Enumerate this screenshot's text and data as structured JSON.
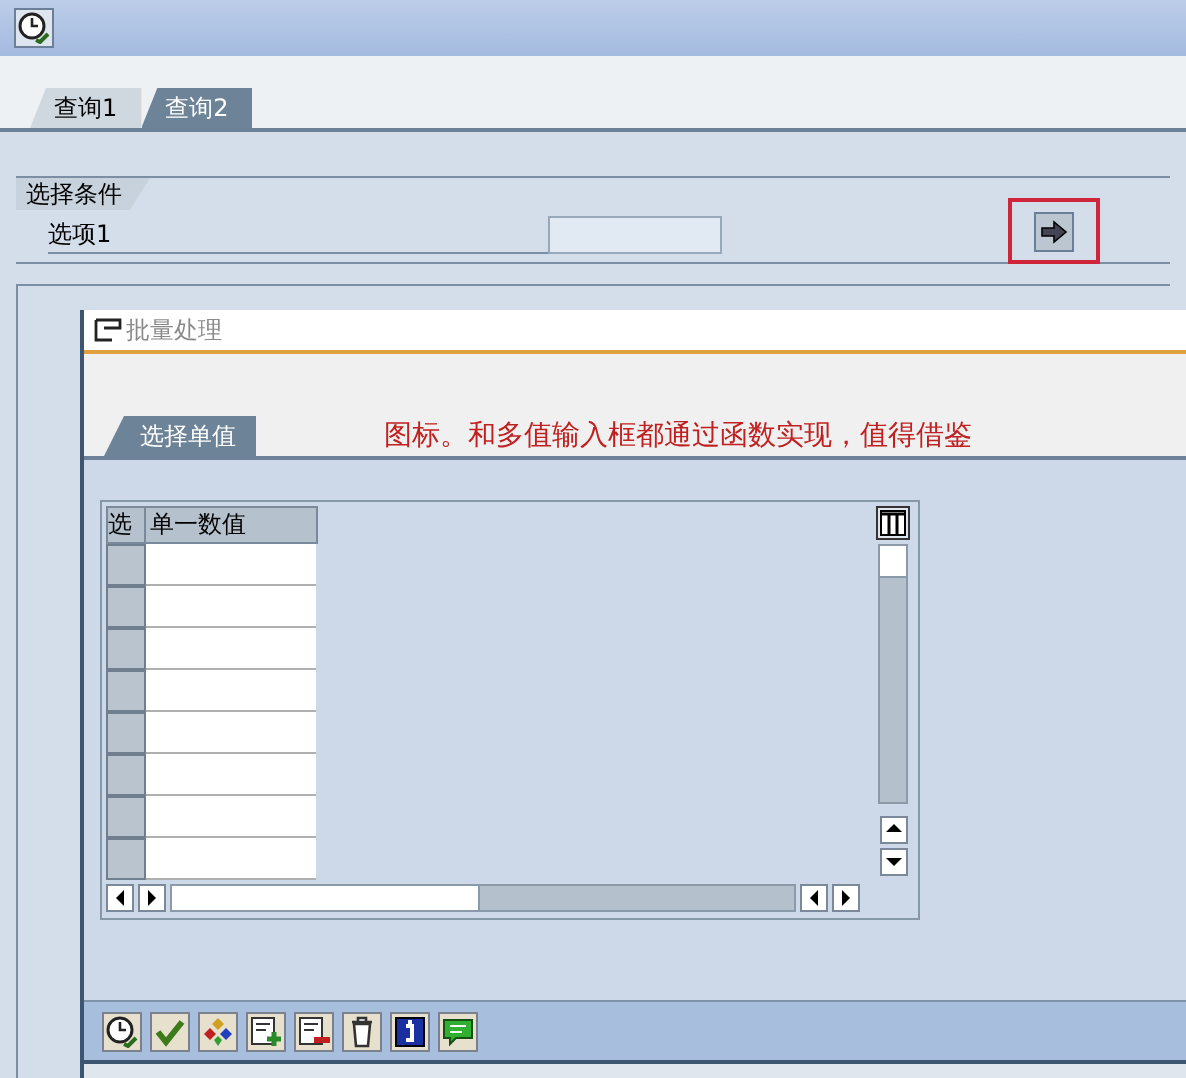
{
  "tabs": [
    {
      "label": "查询1",
      "selected": false
    },
    {
      "label": "查询2",
      "selected": true
    }
  ],
  "selection": {
    "title": "选择条件",
    "field_label": "选项1"
  },
  "dialog": {
    "title": "批量处理",
    "tab": "选择单值",
    "annotation": "图标。和多值输入框都通过函数实现，值得借鉴",
    "table": {
      "columns": [
        "选",
        "单一数值"
      ],
      "rows": [
        {
          "selected": false
        },
        {
          "selected": false
        },
        {
          "selected": false
        },
        {
          "selected": false
        },
        {
          "selected": false
        },
        {
          "selected": false
        },
        {
          "selected": false
        },
        {
          "selected": false
        }
      ]
    },
    "toolbar": [
      {
        "kind": "execute"
      },
      {
        "kind": "check"
      },
      {
        "kind": "diamonds"
      },
      {
        "kind": "add"
      },
      {
        "kind": "remove"
      },
      {
        "kind": "trash"
      },
      {
        "kind": "info"
      },
      {
        "kind": "comment"
      }
    ]
  }
}
